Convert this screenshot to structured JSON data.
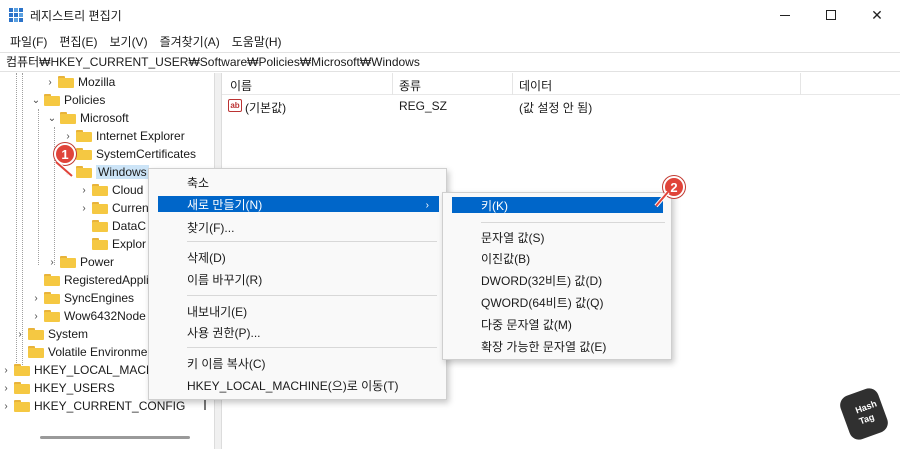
{
  "window": {
    "title": "레지스트리 편집기"
  },
  "menu": [
    "파일(F)",
    "편집(E)",
    "보기(V)",
    "즐겨찾기(A)",
    "도움말(H)"
  ],
  "address": "컴퓨터₩HKEY_CURRENT_USER₩Software₩Policies₩Microsoft₩Windows",
  "tree": [
    {
      "label": "Mozilla",
      "chevron": "right"
    },
    {
      "label": "Policies",
      "chevron": "down"
    },
    {
      "label": "Microsoft",
      "chevron": "down"
    },
    {
      "label": "Internet Explorer",
      "chevron": "right"
    },
    {
      "label": "SystemCertificates",
      "chevron": "right"
    },
    {
      "label": "Windows",
      "chevron": "down",
      "selected": true
    },
    {
      "label": "Cloud",
      "chevron": "right"
    },
    {
      "label": "Curren",
      "chevron": "right"
    },
    {
      "label": "DataC",
      "chevron": ""
    },
    {
      "label": "Explor",
      "chevron": ""
    },
    {
      "label": "Power",
      "chevron": "right"
    },
    {
      "label": "RegisteredAppli",
      "chevron": ""
    },
    {
      "label": "SyncEngines",
      "chevron": "right"
    },
    {
      "label": "Wow6432Node",
      "chevron": "right"
    },
    {
      "label": "System",
      "chevron": "right"
    },
    {
      "label": "Volatile Environme",
      "chevron": ""
    },
    {
      "label": "HKEY_LOCAL_MACHI",
      "chevron": "right"
    },
    {
      "label": "HKEY_USERS",
      "chevron": "right"
    },
    {
      "label": "HKEY_CURRENT_CONFIG",
      "chevron": "right"
    }
  ],
  "list": {
    "columns": [
      "이름",
      "종류",
      "데이터"
    ],
    "rows": [
      {
        "name": "(기본값)",
        "type": "REG_SZ",
        "data": "(값 설정 안 됨)"
      }
    ]
  },
  "context_menu": {
    "items": [
      "축소",
      "새로 만들기(N)",
      "찾기(F)...",
      "삭제(D)",
      "이름 바꾸기(R)",
      "내보내기(E)",
      "사용 권한(P)...",
      "키 이름 복사(C)",
      "HKEY_LOCAL_MACHINE(으)로 이동(T)"
    ],
    "highlighted": "새로 만들기(N)"
  },
  "submenu": {
    "items": [
      "키(K)",
      "문자열 값(S)",
      "이진값(B)",
      "DWORD(32비트) 값(D)",
      "QWORD(64비트) 값(Q)",
      "다중 문자열 값(M)",
      "확장 가능한 문자열 값(E)"
    ],
    "highlighted": "키(K)"
  },
  "badges": [
    "1",
    "2"
  ],
  "logo": {
    "line1": "Hash",
    "line2": "Tag"
  },
  "colors": {
    "highlight": "#0066c9",
    "selection": "#cce4f7",
    "folder": "#f5c842",
    "badge": "#e0443a"
  }
}
